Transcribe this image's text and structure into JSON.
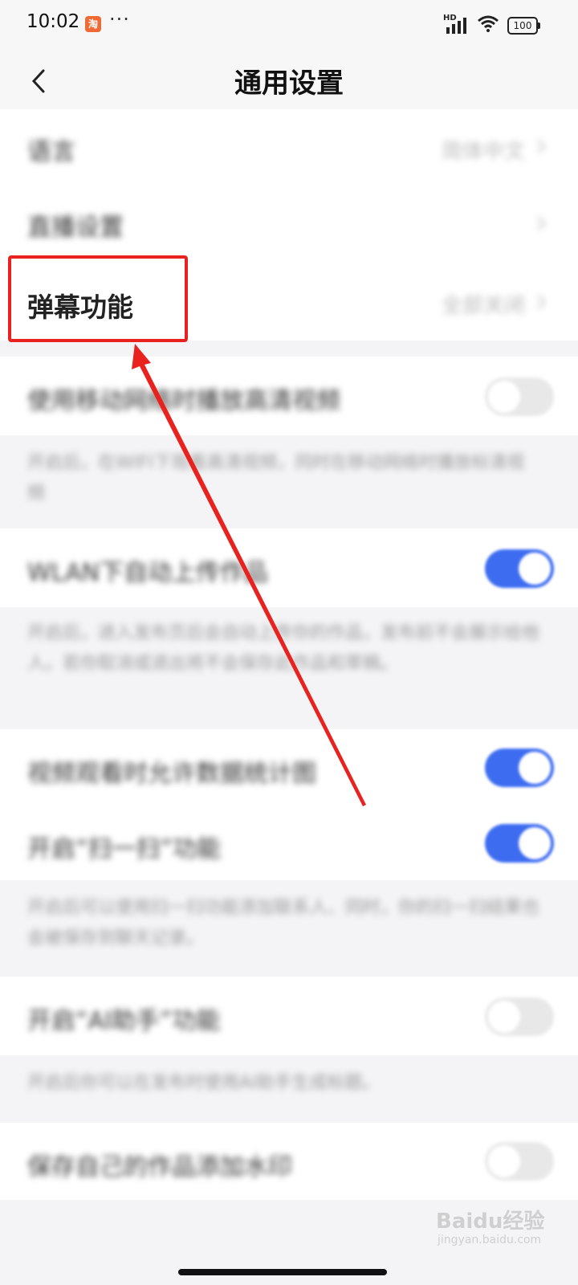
{
  "status_bar": {
    "time": "10:02",
    "app_badge": "淘",
    "more_dots": "···",
    "network": "HD",
    "battery": "100",
    "icons": [
      "signal-icon",
      "wifi-icon",
      "battery-icon"
    ]
  },
  "header": {
    "title": "通用设置",
    "back_icon": "back-chevron-icon"
  },
  "settings": {
    "language": {
      "label": "语言",
      "value": "简体中文"
    },
    "playback": {
      "label": "直播设置"
    },
    "danmu": {
      "label": "弹幕功能",
      "value": "全部关闭"
    },
    "toggle_1": {
      "label": "使用移动网络时播放高清视频",
      "on": false,
      "desc": "开启后，在WIFI下观看高清视频，同时在移动网络时播放标清视频"
    },
    "toggle_2": {
      "label": "WLAN下自动上传作品",
      "on": true,
      "desc": "开启后，进入发布页后会自动上传你的作品，发布前不会展示给他人。若你取消或退出将不会保存此作品和草稿。"
    },
    "toggle_3": {
      "label": "视频观看时允许数据统计图",
      "on": true
    },
    "toggle_4": {
      "label": "开启“扫一扫”功能",
      "on": true,
      "desc": "开启后可以使用扫一扫功能添加联系人、同时，你的扫一扫结果也会被保存到聊天记录。"
    },
    "toggle_5": {
      "label": "开启“AI助手”功能",
      "on": false,
      "desc": "开启后你可以在发布时使用AI助手生成标题。"
    },
    "toggle_6": {
      "label": "保存自己的作品添加水印",
      "on": false
    }
  },
  "watermark": {
    "main": "Baidu经验",
    "sub": "jingyan.baidu.com"
  },
  "colors": {
    "accent": "#3d6cf0",
    "highlight": "#e8231f",
    "background": "#f4f4f6"
  }
}
